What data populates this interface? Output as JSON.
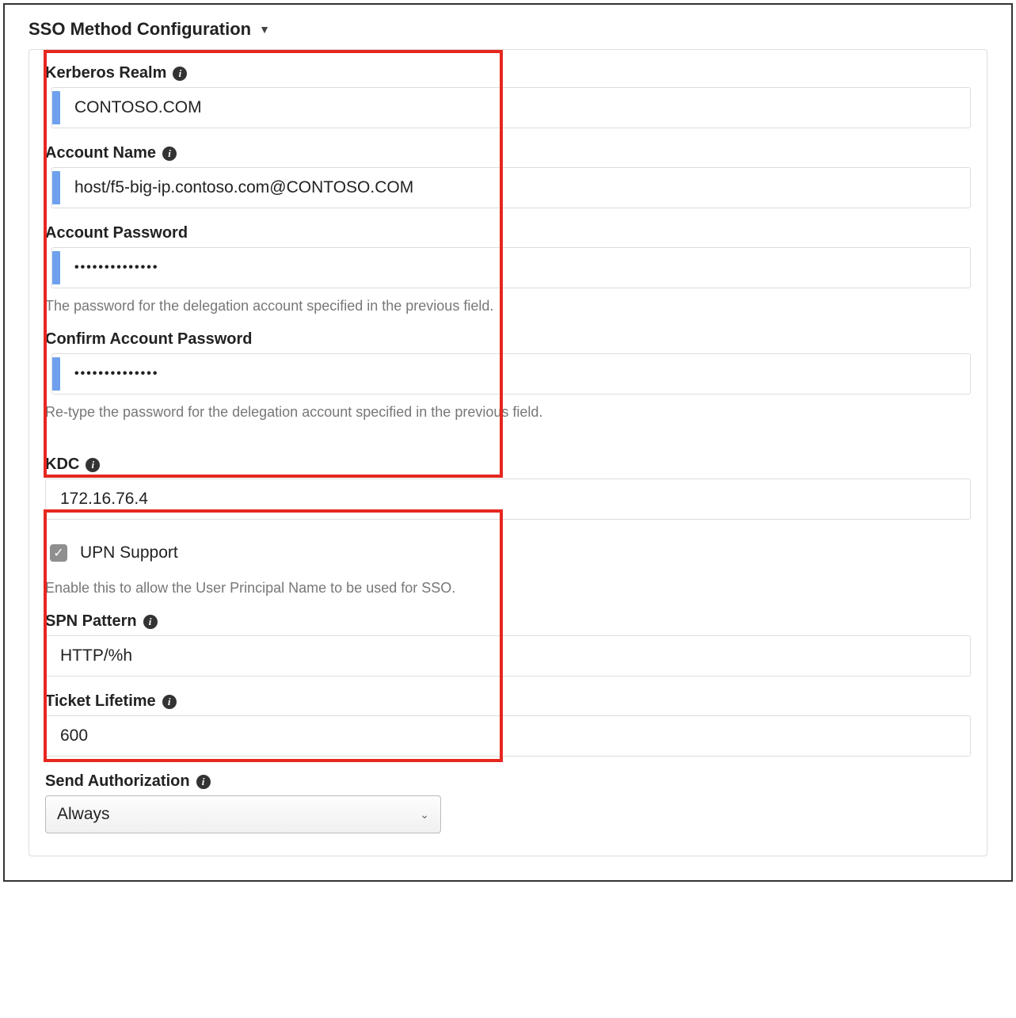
{
  "section": {
    "title": "SSO Method Configuration"
  },
  "fields": {
    "kerberos_realm": {
      "label": "Kerberos Realm",
      "value": "CONTOSO.COM"
    },
    "account_name": {
      "label": "Account Name",
      "value": "host/f5-big-ip.contoso.com@CONTOSO.COM"
    },
    "account_password": {
      "label": "Account Password",
      "value": "••••••••••••••",
      "helper": "The password for the delegation account specified in the previous field."
    },
    "confirm_password": {
      "label": "Confirm Account Password",
      "value": "••••••••••••••",
      "helper": "Re-type the password for the delegation account specified in the previous field."
    },
    "kdc": {
      "label": "KDC",
      "value": "172.16.76.4"
    },
    "upn_support": {
      "label": "UPN Support",
      "checked": true,
      "helper": "Enable this to allow the User Principal Name to be used for SSO."
    },
    "spn_pattern": {
      "label": "SPN Pattern",
      "value": "HTTP/%h"
    },
    "ticket_lifetime": {
      "label": "Ticket Lifetime",
      "value": "600"
    },
    "send_authorization": {
      "label": "Send Authorization",
      "selected": "Always"
    }
  }
}
